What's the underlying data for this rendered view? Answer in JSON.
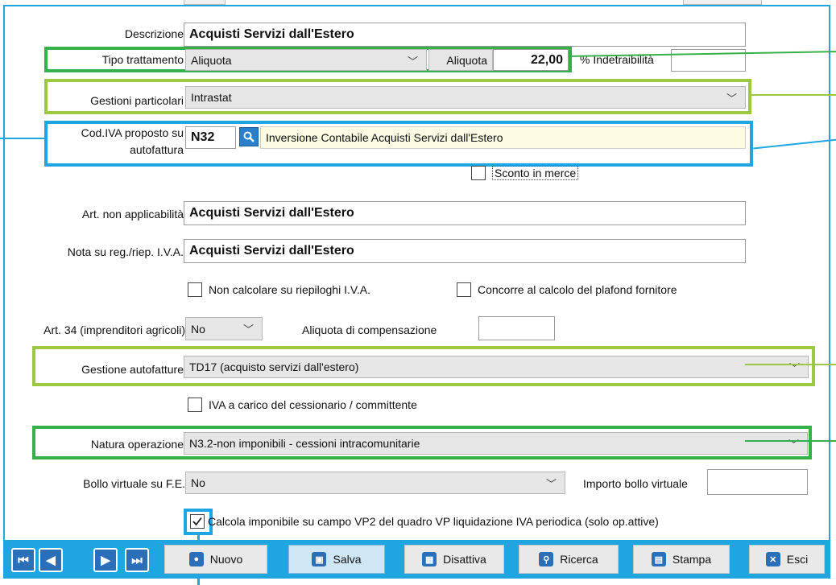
{
  "form": {
    "descrizione": {
      "label": "Descrizione",
      "value": "Acquisti Servizi dall'Estero"
    },
    "tipo_trattamento": {
      "label": "Tipo trattamento",
      "value": "Aliquota"
    },
    "aliquota": {
      "label": "Aliquota",
      "value": "22,00"
    },
    "indetraibilita": {
      "label": "% Indetraibilità",
      "value": ""
    },
    "gestioni_particolari": {
      "label": "Gestioni particolari",
      "value": "Intrastat"
    },
    "cod_iva": {
      "label_line1": "Cod.IVA proposto su",
      "label_line2": "autofattura",
      "code": "N32",
      "description": "Inversione Contabile Acquisti Servizi dall'Estero"
    },
    "sconto_in_merce": {
      "label": "Sconto in merce",
      "checked": false
    },
    "art_non_applicabilita": {
      "label": "Art. non applicabilità",
      "value": "Acquisti Servizi dall'Estero"
    },
    "nota_reg": {
      "label": "Nota su reg./riep. I.V.A.",
      "value": "Acquisti Servizi dall'Estero"
    },
    "non_calcolare": {
      "label": "Non calcolare su riepiloghi I.V.A.",
      "checked": false
    },
    "concorre_plafond": {
      "label": "Concorre al calcolo del plafond fornitore",
      "checked": false
    },
    "art34": {
      "label": "Art. 34 (imprenditori agricoli)",
      "value": "No"
    },
    "aliquota_compensazione": {
      "label": "Aliquota di compensazione",
      "value": ""
    },
    "gestione_autofatture": {
      "label": "Gestione autofatture",
      "value": "TD17 (acquisto servizi dall'estero)"
    },
    "iva_carico": {
      "label": "IVA a carico del cessionario / committente",
      "checked": false
    },
    "natura_operazione": {
      "label": "Natura operazione",
      "value": "N3.2-non imponibili - cessioni intracomunitarie"
    },
    "bollo_virtuale": {
      "label": "Bollo virtuale su F.E.",
      "value": "No"
    },
    "importo_bollo": {
      "label": "Importo bollo virtuale",
      "value": ""
    },
    "calcola_imponibile": {
      "label": "Calcola imponibile su campo VP2 del quadro VP liquidazione IVA periodica (solo op.attive)",
      "checked": true
    }
  },
  "toolbar": {
    "nav": [
      "⏮",
      "◀",
      "▶",
      "⏭"
    ],
    "buttons": [
      {
        "label": "Nuovo",
        "icon": "new-icon"
      },
      {
        "label": "Salva",
        "icon": "save-icon"
      },
      {
        "label": "Disattiva",
        "icon": "deactivate-icon"
      },
      {
        "label": "Ricerca",
        "icon": "search-icon"
      },
      {
        "label": "Stampa",
        "icon": "print-icon"
      },
      {
        "label": "Esci",
        "icon": "close-icon"
      }
    ]
  },
  "colors": {
    "frame": "#1fa5e0",
    "green": "#36b049",
    "light_green": "#9dc841",
    "blue": "#1ea5e2",
    "highlight": "#fdfbe3"
  }
}
